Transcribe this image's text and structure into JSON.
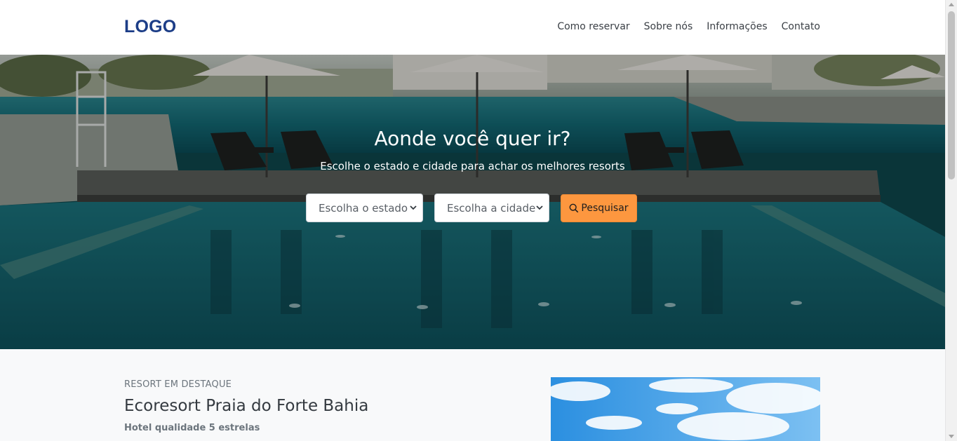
{
  "header": {
    "logo": "LOGO",
    "nav": [
      {
        "label": "Como reservar"
      },
      {
        "label": "Sobre nós"
      },
      {
        "label": "Informações"
      },
      {
        "label": "Contato"
      }
    ]
  },
  "hero": {
    "title": "Aonde você quer ir?",
    "subtitle": "Escolhe o estado e cidade para achar os melhores resorts",
    "state_select": {
      "value": "Escolha o estado"
    },
    "city_select": {
      "value": "Escolha a cidade"
    },
    "search_button": {
      "label": "Pesquisar",
      "icon": "search-icon"
    }
  },
  "featured": {
    "eyebrow": "RESORT EM DESTAQUE",
    "name": "Ecoresort Praia do Forte Bahia",
    "rating": "Hotel qualidade 5 estrelas"
  },
  "colors": {
    "brand": "#1c3d87",
    "accent": "#fd973f",
    "text": "#343a40",
    "muted": "#6c757d"
  }
}
